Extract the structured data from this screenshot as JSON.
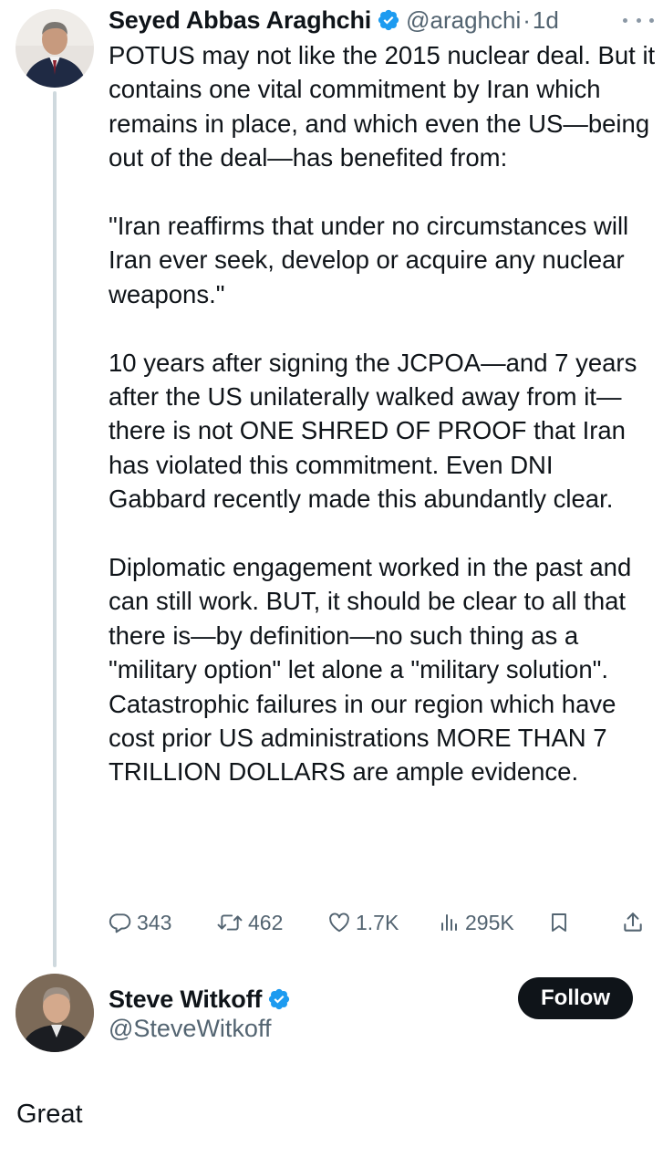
{
  "tweet1": {
    "author": {
      "name": "Seyed Abbas Araghchi",
      "handle": "@araghchi",
      "separator": "·",
      "time": "1d"
    },
    "paragraphs": [
      "POTUS may not like the 2015 nuclear deal. But it contains one vital commitment by Iran which remains in place, and which even the US—being out of the deal—has benefited from:",
      "\"Iran reaffirms that under no circumstances will Iran ever seek, develop or acquire any nuclear weapons.\"",
      "10 years after signing the JCPOA—and 7 years after the US unilaterally walked away from it—there is not ONE SHRED OF PROOF that Iran has violated this commitment. Even DNI Gabbard recently made this abundantly clear.",
      "Diplomatic engagement worked in the past and can still work. BUT, it should be clear to all that there is—by definition—no such thing as a \"military option\" let alone a \"military solution\". Catastrophic failures in our region which have cost prior US administrations MORE THAN 7 TRILLION DOLLARS are ample evidence."
    ],
    "stats": {
      "replies": "343",
      "retweets": "462",
      "likes": "1.7K",
      "views": "295K"
    }
  },
  "tweet2": {
    "author": {
      "name": "Steve Witkoff",
      "handle": "@SteveWitkoff"
    },
    "follow_label": "Follow",
    "text": "Great"
  },
  "colors": {
    "text": "#0f1419",
    "secondary": "#536471",
    "verified": "#1d9bf0",
    "thread_line": "#cfd9de",
    "follow_bg": "#0f1419"
  },
  "icons": {
    "verified": "verified-badge-icon",
    "more": "more-horizontal-icon",
    "reply": "reply-icon",
    "retweet": "retweet-icon",
    "like": "heart-icon",
    "views": "views-chart-icon",
    "bookmark": "bookmark-icon",
    "share": "share-icon"
  }
}
